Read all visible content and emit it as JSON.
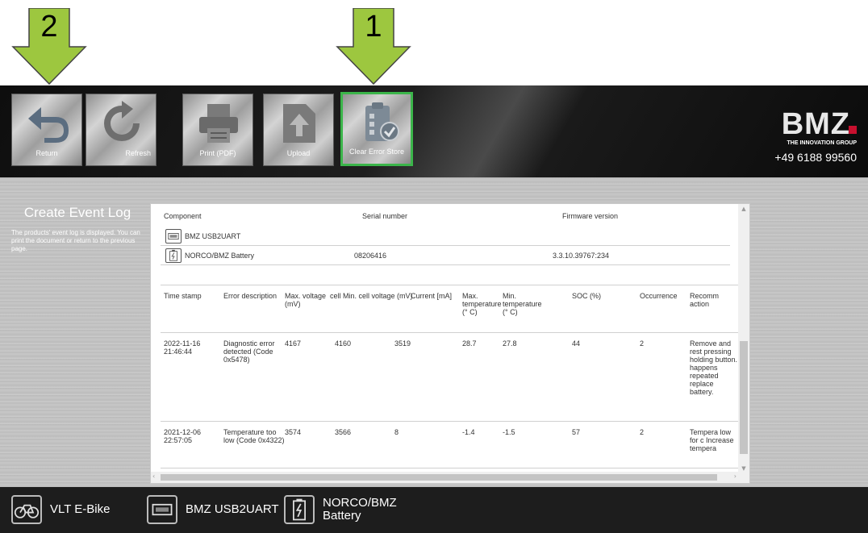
{
  "annotations": {
    "arrow_1": "1",
    "arrow_2": "2"
  },
  "toolbar": {
    "buttons": [
      {
        "label": "Return",
        "icon": "return-icon"
      },
      {
        "label": "Refresh",
        "icon": "refresh-icon"
      },
      {
        "label": "Print (PDF)",
        "icon": "printer-icon"
      },
      {
        "label": "Upload",
        "icon": "upload-icon"
      },
      {
        "label": "Clear Error Store",
        "icon": "clipboard-check-icon"
      }
    ],
    "active_color": "#3bb54a"
  },
  "brand": {
    "logo": "BMZ",
    "tagline": "THE INNOVATION GROUP",
    "phone": "+49 6188 99560",
    "accent": "#c8102e"
  },
  "sidebar": {
    "title": "Create Event Log",
    "description": "The products' event log is displayed. You can print the document or return to the previous page."
  },
  "components": {
    "headers": [
      "Component",
      "Serial number",
      "Firmware version"
    ],
    "rows": [
      {
        "name": "BMZ USB2UART",
        "serial": "",
        "firmware": "",
        "icon": "usb-uart-icon"
      },
      {
        "name": "NORCO/BMZ Battery",
        "serial": "08206416",
        "firmware": "3.3.10.39767:234",
        "icon": "battery-icon"
      }
    ]
  },
  "events": {
    "headers": [
      "Time stamp",
      "Error description",
      "Max. voltage (mV)",
      "cell Min. cell voltage (mV)",
      "Current [mA]",
      "",
      "Max. temperature (° C)",
      "Min. temperature (° C)",
      "SOC (%)",
      "Occurrence",
      "Recommended action"
    ],
    "header_lines": {
      "h0": "Time stamp",
      "h1": "Error description",
      "h2": "Max. voltage (mV)",
      "h3": "cell Min. cell voltage (mV)",
      "h4": "Current [mA]",
      "h6": "Max. temperature (° C)",
      "h7": "Min. temperature (° C)",
      "h8": "SOC (%)",
      "h9": "Occurrence",
      "h10": "Recomm action"
    },
    "rows": [
      {
        "timestamp": "2022-11-16 21:46:44",
        "error": "Diagnostic error detected (Code 0x5478)",
        "max_voltage": "4167",
        "min_voltage": "4160",
        "current": "3519",
        "max_temp": "28.7",
        "min_temp": "27.8",
        "soc": "44",
        "occurrence": "2",
        "action": "Remove and rest pressing holding button. happens repeated replace battery."
      },
      {
        "timestamp": "2021-12-06 22:57:05",
        "error": "Temperature too low (Code 0x4322)",
        "max_voltage": "3574",
        "min_voltage": "3566",
        "current": "8",
        "max_temp": "-1.4",
        "min_temp": "-1.5",
        "soc": "57",
        "occurrence": "2",
        "action": "Tempera low for c Increase tempera"
      }
    ]
  },
  "bottombar": {
    "items": [
      {
        "label": "VLT E-Bike",
        "icon": "bike-icon"
      },
      {
        "label": "BMZ USB2UART",
        "icon": "usb-uart-icon"
      },
      {
        "label": "NORCO/BMZ Battery",
        "icon": "battery-icon"
      }
    ]
  }
}
